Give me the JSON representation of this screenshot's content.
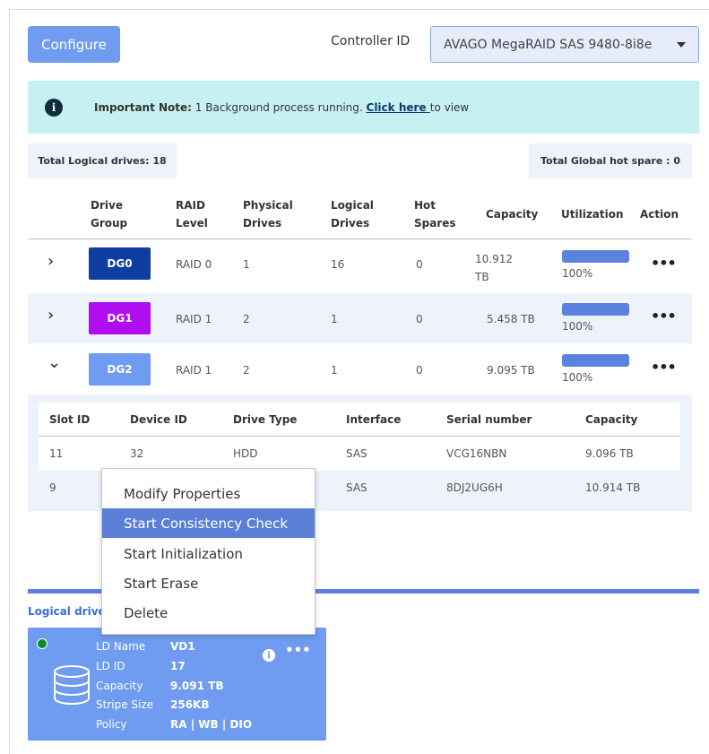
{
  "header": {
    "configure_label": "Configure",
    "controller_label": "Controller ID",
    "controller_value": "AVAGO MegaRAID SAS 9480-8i8e"
  },
  "note": {
    "prefix": "Important Note:",
    "text": " 1 Background process running. ",
    "link": "Click here ",
    "suffix": "to view"
  },
  "totals": {
    "logical": "Total Logical drives: 18",
    "hotspare": "Total Global hot spare : 0"
  },
  "table": {
    "headers": {
      "drive_group": [
        "Drive",
        "Group"
      ],
      "raid_level": [
        "RAID",
        "Level"
      ],
      "physical": [
        "Physical",
        "Drives"
      ],
      "logical": [
        "Logical",
        "Drives"
      ],
      "hot_spares": [
        "Hot",
        "Spares"
      ],
      "capacity": "Capacity",
      "utilization": "Utilization",
      "action": "Action"
    },
    "rows": [
      {
        "chevron": "›",
        "dg": "DG0",
        "dg_color": "#0f3ea0",
        "raid": "RAID 0",
        "physical": "1",
        "logical": "16",
        "hot": "0",
        "capacity": [
          "10.912",
          "TB"
        ],
        "utilization": "100%",
        "utilization_fill": 1.0
      },
      {
        "chevron": "›",
        "dg": "DG1",
        "dg_color": "#b10cf0",
        "raid": "RAID 1",
        "physical": "2",
        "logical": "1",
        "hot": "0",
        "capacity": "5.458 TB",
        "utilization": "100%",
        "utilization_fill": 1.0
      },
      {
        "chevron": "⌄",
        "dg": "DG2",
        "dg_color": "#6f9cf0",
        "raid": "RAID 1",
        "physical": "2",
        "logical": "1",
        "hot": "0",
        "capacity": "9.095 TB",
        "utilization": "100%",
        "utilization_fill": 1.0
      }
    ]
  },
  "subtable": {
    "headers": {
      "slot": "Slot ID",
      "device": "Device ID",
      "type": "Drive Type",
      "interface": "Interface",
      "serial": "Serial number",
      "capacity": "Capacity"
    },
    "rows": [
      {
        "slot": "11",
        "device": "32",
        "type": "HDD",
        "interface": "SAS",
        "serial": "VCG16NBN",
        "capacity": "9.096 TB"
      },
      {
        "slot": "9",
        "device": "",
        "type": "",
        "interface": "SAS",
        "serial": "8DJ2UG6H",
        "capacity": "10.914 TB"
      }
    ]
  },
  "context_menu": {
    "items": [
      "Modify Properties",
      "Start Consistency Check",
      "Start Initialization",
      "Start Erase",
      "Delete"
    ],
    "active_index": 1
  },
  "logical_drives": {
    "section_label": "Logical drive",
    "card": {
      "status_color": "#0a8a2a",
      "fields": [
        {
          "key": "LD Name",
          "value": "VD1"
        },
        {
          "key": "LD ID",
          "value": "17"
        },
        {
          "key": "Capacity",
          "value": "9.091 TB"
        },
        {
          "key": "Stripe Size",
          "value": "256KB"
        },
        {
          "key": "Policy",
          "value": "RA | WB | DIO"
        }
      ]
    }
  },
  "icons": {
    "info": "i",
    "more": "•••",
    "database": "database-icon"
  },
  "colors": {
    "accent": "#6f9cf0",
    "note_bg": "#c7f0f2",
    "row_shade": "#eef2fa",
    "menu_active": "#5b7fd6"
  }
}
